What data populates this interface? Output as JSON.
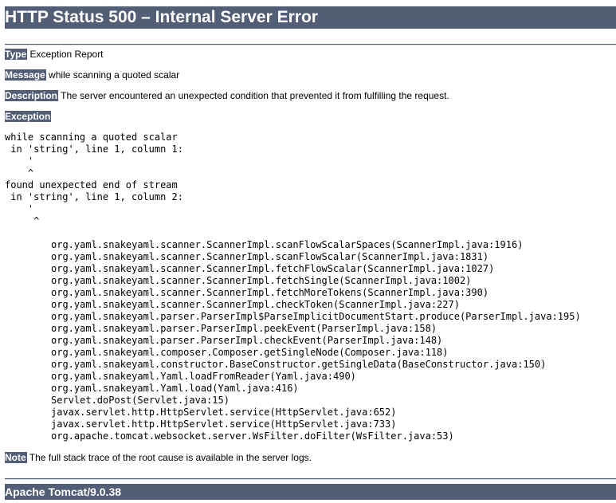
{
  "title": "HTTP Status 500 – Internal Server Error",
  "type": {
    "label": "Type",
    "value": "Exception Report"
  },
  "message": {
    "label": "Message",
    "value": "while scanning a quoted scalar"
  },
  "description": {
    "label": "Description",
    "value": "The server encountered an unexpected condition that prevented it from fulfilling the request."
  },
  "exception": {
    "label": "Exception",
    "message_text": "while scanning a quoted scalar\n in 'string', line 1, column 1:\n    '\n    ^\nfound unexpected end of stream\n in 'string', line 1, column 2:\n    '\n     ^",
    "stack_trace": "org.yaml.snakeyaml.scanner.ScannerImpl.scanFlowScalarSpaces(ScannerImpl.java:1916)\norg.yaml.snakeyaml.scanner.ScannerImpl.scanFlowScalar(ScannerImpl.java:1831)\norg.yaml.snakeyaml.scanner.ScannerImpl.fetchFlowScalar(ScannerImpl.java:1027)\norg.yaml.snakeyaml.scanner.ScannerImpl.fetchSingle(ScannerImpl.java:1002)\norg.yaml.snakeyaml.scanner.ScannerImpl.fetchMoreTokens(ScannerImpl.java:390)\norg.yaml.snakeyaml.scanner.ScannerImpl.checkToken(ScannerImpl.java:227)\norg.yaml.snakeyaml.parser.ParserImpl$ParseImplicitDocumentStart.produce(ParserImpl.java:195)\norg.yaml.snakeyaml.parser.ParserImpl.peekEvent(ParserImpl.java:158)\norg.yaml.snakeyaml.parser.ParserImpl.checkEvent(ParserImpl.java:148)\norg.yaml.snakeyaml.composer.Composer.getSingleNode(Composer.java:118)\norg.yaml.snakeyaml.constructor.BaseConstructor.getSingleData(BaseConstructor.java:150)\norg.yaml.snakeyaml.Yaml.loadFromReader(Yaml.java:490)\norg.yaml.snakeyaml.Yaml.load(Yaml.java:416)\nServlet.doPost(Servlet.java:15)\njavax.servlet.http.HttpServlet.service(HttpServlet.java:652)\njavax.servlet.http.HttpServlet.service(HttpServlet.java:733)\norg.apache.tomcat.websocket.server.WsFilter.doFilter(WsFilter.java:53)"
  },
  "note": {
    "label": "Note",
    "value": "The full stack trace of the root cause is available in the server logs."
  },
  "footer": "Apache Tomcat/9.0.38",
  "colors": {
    "accent": "#525D76",
    "text": "#000000",
    "background": "#ffffff"
  }
}
